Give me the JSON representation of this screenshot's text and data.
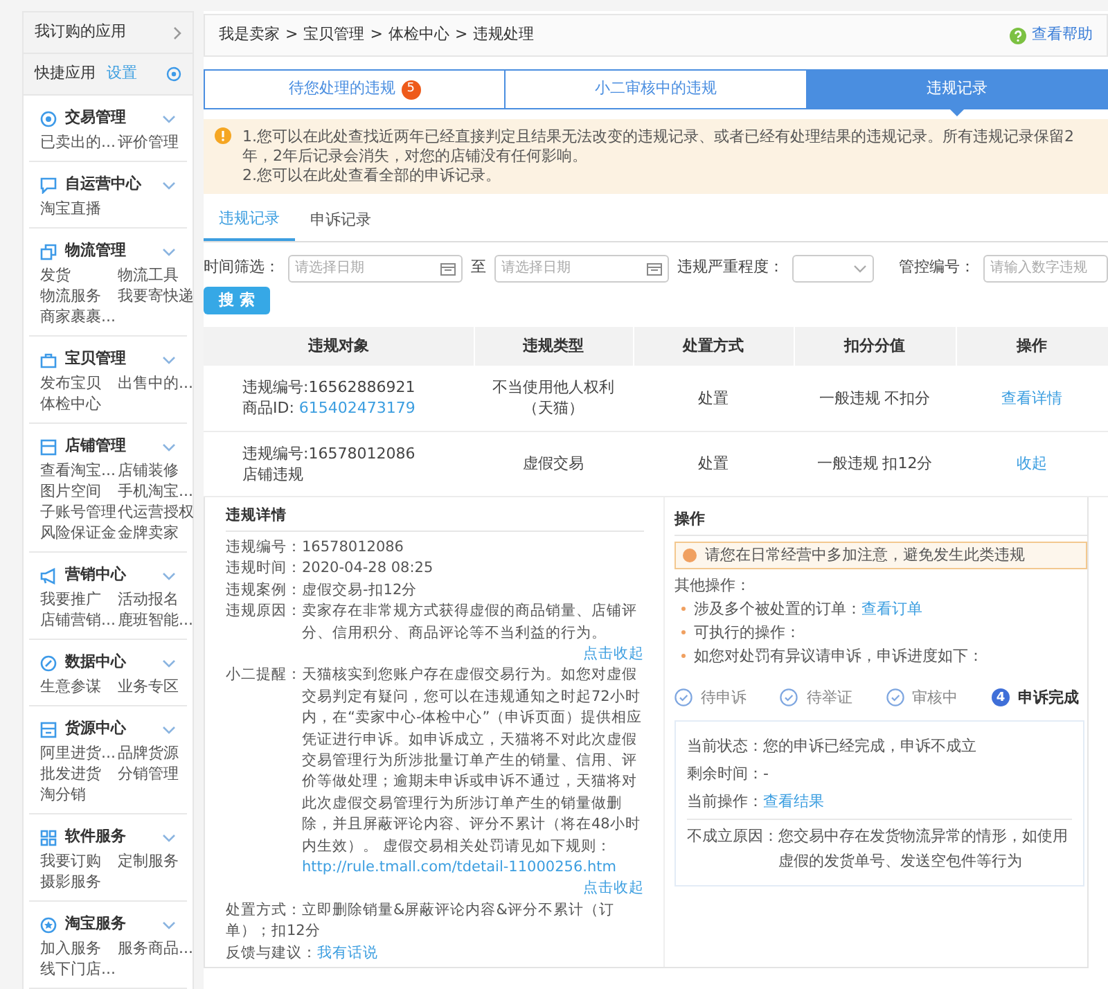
{
  "sidebar": {
    "my_apps": "我订购的应用",
    "quick_label": "快捷应用",
    "quick_link": "设置",
    "groups": [
      {
        "title": "交易管理",
        "items": [
          "已卖出的...",
          "评价管理"
        ]
      },
      {
        "title": "自运营中心",
        "items": [
          "淘宝直播"
        ]
      },
      {
        "title": "物流管理",
        "items": [
          "发货",
          "物流工具",
          "物流服务",
          "我要寄快递",
          "商家裹裹..."
        ]
      },
      {
        "title": "宝贝管理",
        "items": [
          "发布宝贝",
          "出售中的...",
          "体检中心"
        ]
      },
      {
        "title": "店铺管理",
        "items": [
          "查看淘宝...",
          "店铺装修",
          "图片空间",
          "手机淘宝...",
          "子账号管理",
          "代运营授权",
          "风险保证金",
          "金牌卖家"
        ]
      },
      {
        "title": "营销中心",
        "items": [
          "我要推广",
          "活动报名",
          "店铺营销...",
          "鹿班智能..."
        ]
      },
      {
        "title": "数据中心",
        "items": [
          "生意参谋",
          "业务专区"
        ]
      },
      {
        "title": "货源中心",
        "items": [
          "阿里进货...",
          "品牌货源",
          "批发进货",
          "分销管理",
          "淘分销"
        ]
      },
      {
        "title": "软件服务",
        "items": [
          "我要订购",
          "定制服务",
          "摄影服务"
        ]
      },
      {
        "title": "淘宝服务",
        "items": [
          "加入服务",
          "服务商品...",
          "线下门店..."
        ]
      }
    ]
  },
  "breadcrumb": {
    "items": [
      "我是卖家",
      "宝贝管理",
      "体检中心",
      "违规处理"
    ],
    "separator": ">",
    "help": "查看帮助"
  },
  "tabs": [
    {
      "label": "待您处理的违规",
      "badge": "5",
      "selected": false
    },
    {
      "label": "小二审核中的违规",
      "selected": false
    },
    {
      "label": "违规记录",
      "selected": true
    }
  ],
  "notice": [
    "1.您可以在此处查找近两年已经直接判定且结果无法改变的违规记录、或者已经有处理结果的违规记录。所有违规记录保留2年，2年后记录会消失，对您的店铺没有任何影响。",
    "2.您可以在此处查看全部的申诉记录。"
  ],
  "subtabs": [
    {
      "label": "违规记录",
      "selected": true
    },
    {
      "label": "申诉记录",
      "selected": false
    }
  ],
  "filters": {
    "time_label": "时间筛选：",
    "date_from": {
      "placeholder": "请选择日期"
    },
    "to": "至",
    "date_to": {
      "placeholder": "请选择日期"
    },
    "severity_label": "违规严重程度：",
    "control_label": "管控编号：",
    "control": {
      "placeholder": "请输入数字违规"
    },
    "search": "搜 索"
  },
  "table": {
    "columns": [
      "违规对象",
      "违规类型",
      "处置方式",
      "扣分分值",
      "操作"
    ],
    "rows": [
      {
        "id_text": "违规编号:16562886921",
        "sub_label": "商品ID: ",
        "sub_link": "615402473179",
        "type": "不当使用他人权利（天猫）",
        "action": "处置",
        "score": "一般违规 不扣分",
        "operation": "查看详情"
      },
      {
        "id_text": "违规编号:16578012086",
        "sub_label": "店铺违规",
        "type": "虚假交易",
        "action": "处置",
        "score": "一般违规 扣12分",
        "operation": "收起"
      }
    ]
  },
  "detail": {
    "title": "违规详情",
    "fields": [
      {
        "kind": "hanging",
        "label": "违规编号：",
        "value": "16578012086"
      },
      {
        "kind": "hanging",
        "label": "违规时间：",
        "value": "2020-04-28 08:25"
      },
      {
        "kind": "hanging",
        "label": "违规案例：",
        "value": "虚假交易-扣12分"
      },
      {
        "kind": "hanging",
        "label": "违规原因：",
        "value": "卖家存在非常规方式获得虚假的商品销量、店铺评分、信用积分、商品评论等不当利益的行为。",
        "toggle": "点击收起"
      },
      {
        "kind": "hanging",
        "label": "小二提醒：",
        "value": "天猫核实到您账户存在虚假交易行为。如您对虚假交易判定有疑问，您可以在违规通知之时起72小时内，在“卖家中心-体检中心”（申诉页面）提供相应凭证进行申诉。如申诉成立，天猫将不对此次虚假交易管理行为所涉批量订单产生的销量、信用、评价等做处理；逾期未申诉或申诉不通过，天猫将对此次虚假交易管理行为所涉订单产生的销量做删除，并且屏蔽评论内容、评分不累计（将在48小时内生效）。 虚假交易相关处罚请见如下规则：",
        "link": "http://rule.tmall.com/tdetail-11000256.htm",
        "toggle": "点击收起"
      },
      {
        "kind": "inline",
        "label": "处置方式：",
        "value": "立即删除销量&屏蔽评论内容&评分不累计（订单）；扣12分"
      },
      {
        "kind": "inline",
        "label": "反馈与建议：",
        "link": "我有话说"
      }
    ]
  },
  "operations": {
    "title": "操作",
    "tip": "请您在日常经营中多加注意，避免发生此类违规",
    "other_label": "其他操作：",
    "bullets": [
      {
        "text": "涉及多个被处置的订单：",
        "link": "查看订单"
      },
      {
        "text": "可执行的操作："
      },
      {
        "text": "如您对处罚有异议请申诉，申诉进度如下："
      }
    ],
    "steps": [
      {
        "label": "待申诉",
        "selected": false
      },
      {
        "label": "待举证",
        "selected": false
      },
      {
        "label": "审核中",
        "selected": false
      },
      {
        "label": "申诉完成",
        "number": "4",
        "selected": true
      }
    ],
    "status_lines": [
      {
        "text": "当前状态：您的申诉已经完成，申诉不成立"
      },
      {
        "text": "剩余时间：-"
      },
      {
        "text": "当前操作：",
        "link": "查看结果"
      }
    ],
    "reason": {
      "label": "不成立原因：",
      "value": "您交易中存在发货物流异常的情形，如使用虚假的发货单号、发送空包件等行为"
    }
  }
}
